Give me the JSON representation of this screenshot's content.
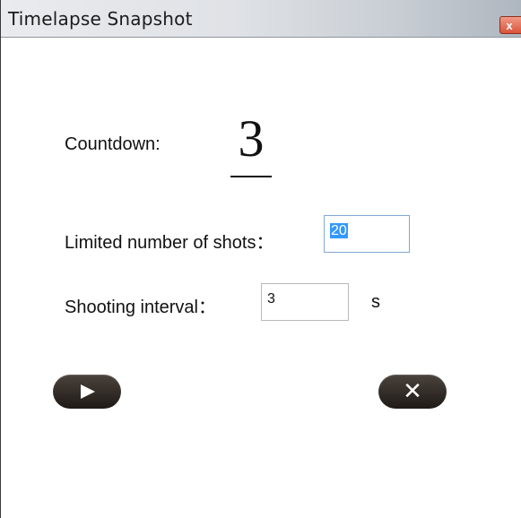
{
  "window": {
    "title": "Timelapse Snapshot",
    "close_glyph": "x"
  },
  "form": {
    "countdown_label": "Countdown:",
    "countdown_value": "3",
    "shots_label": "Limited number of shots：",
    "shots_value": "20",
    "interval_label": "Shooting interval：",
    "interval_value": "3",
    "interval_unit": "s"
  },
  "buttons": {
    "play_icon": "play-icon",
    "cancel_icon": "close-icon",
    "cancel_glyph": "✕"
  },
  "colors": {
    "button_bg": "#2b2421",
    "selection": "#3399ff"
  }
}
